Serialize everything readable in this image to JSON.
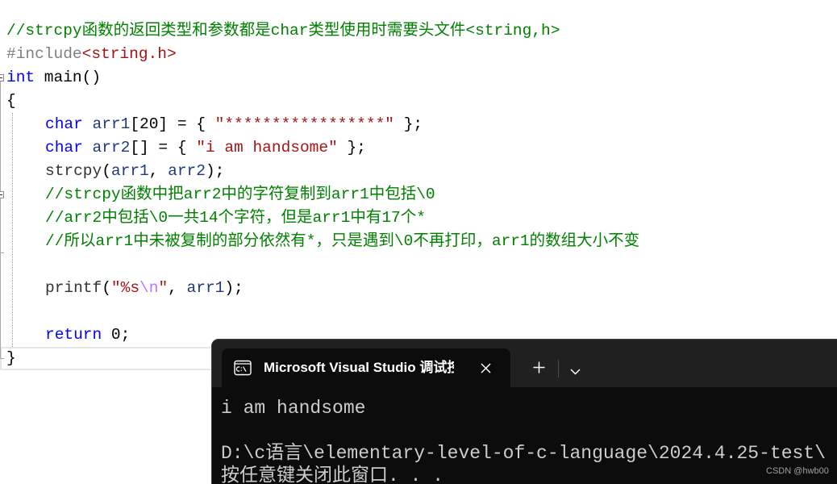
{
  "editor": {
    "lines": [
      [
        "//strcpy函数的返回类型和参数都是char类型使用时需要头文件<string,h>"
      ],
      [
        "#include",
        "<string.h>"
      ],
      [
        "int",
        " main",
        "()"
      ],
      [
        "{"
      ],
      [
        "char",
        " arr1",
        "[20] = { ",
        "\"*****************\"",
        " };"
      ],
      [
        "char",
        " arr2",
        "[] = { ",
        "\"i am handsome\"",
        " };"
      ],
      [
        "strcpy",
        "(",
        "arr1",
        ", ",
        "arr2",
        ");"
      ],
      [
        "//strcpy函数中把arr2中的字符复制到arr1中包括\\0"
      ],
      [
        "//arr2中包括\\0一共14个字符，但是arr1中有17个*"
      ],
      [
        "//所以arr1中未被复制的部分依然有*，只是遇到\\0不再打印，arr1的数组大小不变"
      ],
      [],
      [
        "printf",
        "(",
        "\"%s",
        "\\n",
        "\"",
        ", ",
        "arr1",
        ");"
      ],
      [],
      [
        "return",
        " 0;"
      ],
      [
        "}"
      ]
    ]
  },
  "terminal": {
    "tab_title": "Microsoft Visual Studio 调试控",
    "output_lines": [
      "i am handsome",
      "",
      "D:\\c语言\\elementary-level-of-c-language\\2024.4.25-test\\",
      "按任意键关闭此窗口. . ."
    ]
  },
  "icons": {
    "fold_toggle": "collapse-icon",
    "tab_icon": "console-app-icon",
    "tab_close": "close-icon",
    "new_tab": "plus-icon",
    "tab_dropdown": "chevron-down-icon"
  },
  "watermark": "CSDN @hwb00",
  "theme": {
    "comment": "#008000",
    "keyword": "#0000ff",
    "preprocessor": "#808080",
    "string": "#a31515",
    "escape": "#b776fb",
    "identifier": "#1f377f",
    "function": "#333333",
    "plain": "#000000",
    "terminal_bg": "#0c0c0c",
    "terminal_fg": "#cccccc",
    "tab_bar": "#202020",
    "tab_active": "#0c0c0c"
  }
}
